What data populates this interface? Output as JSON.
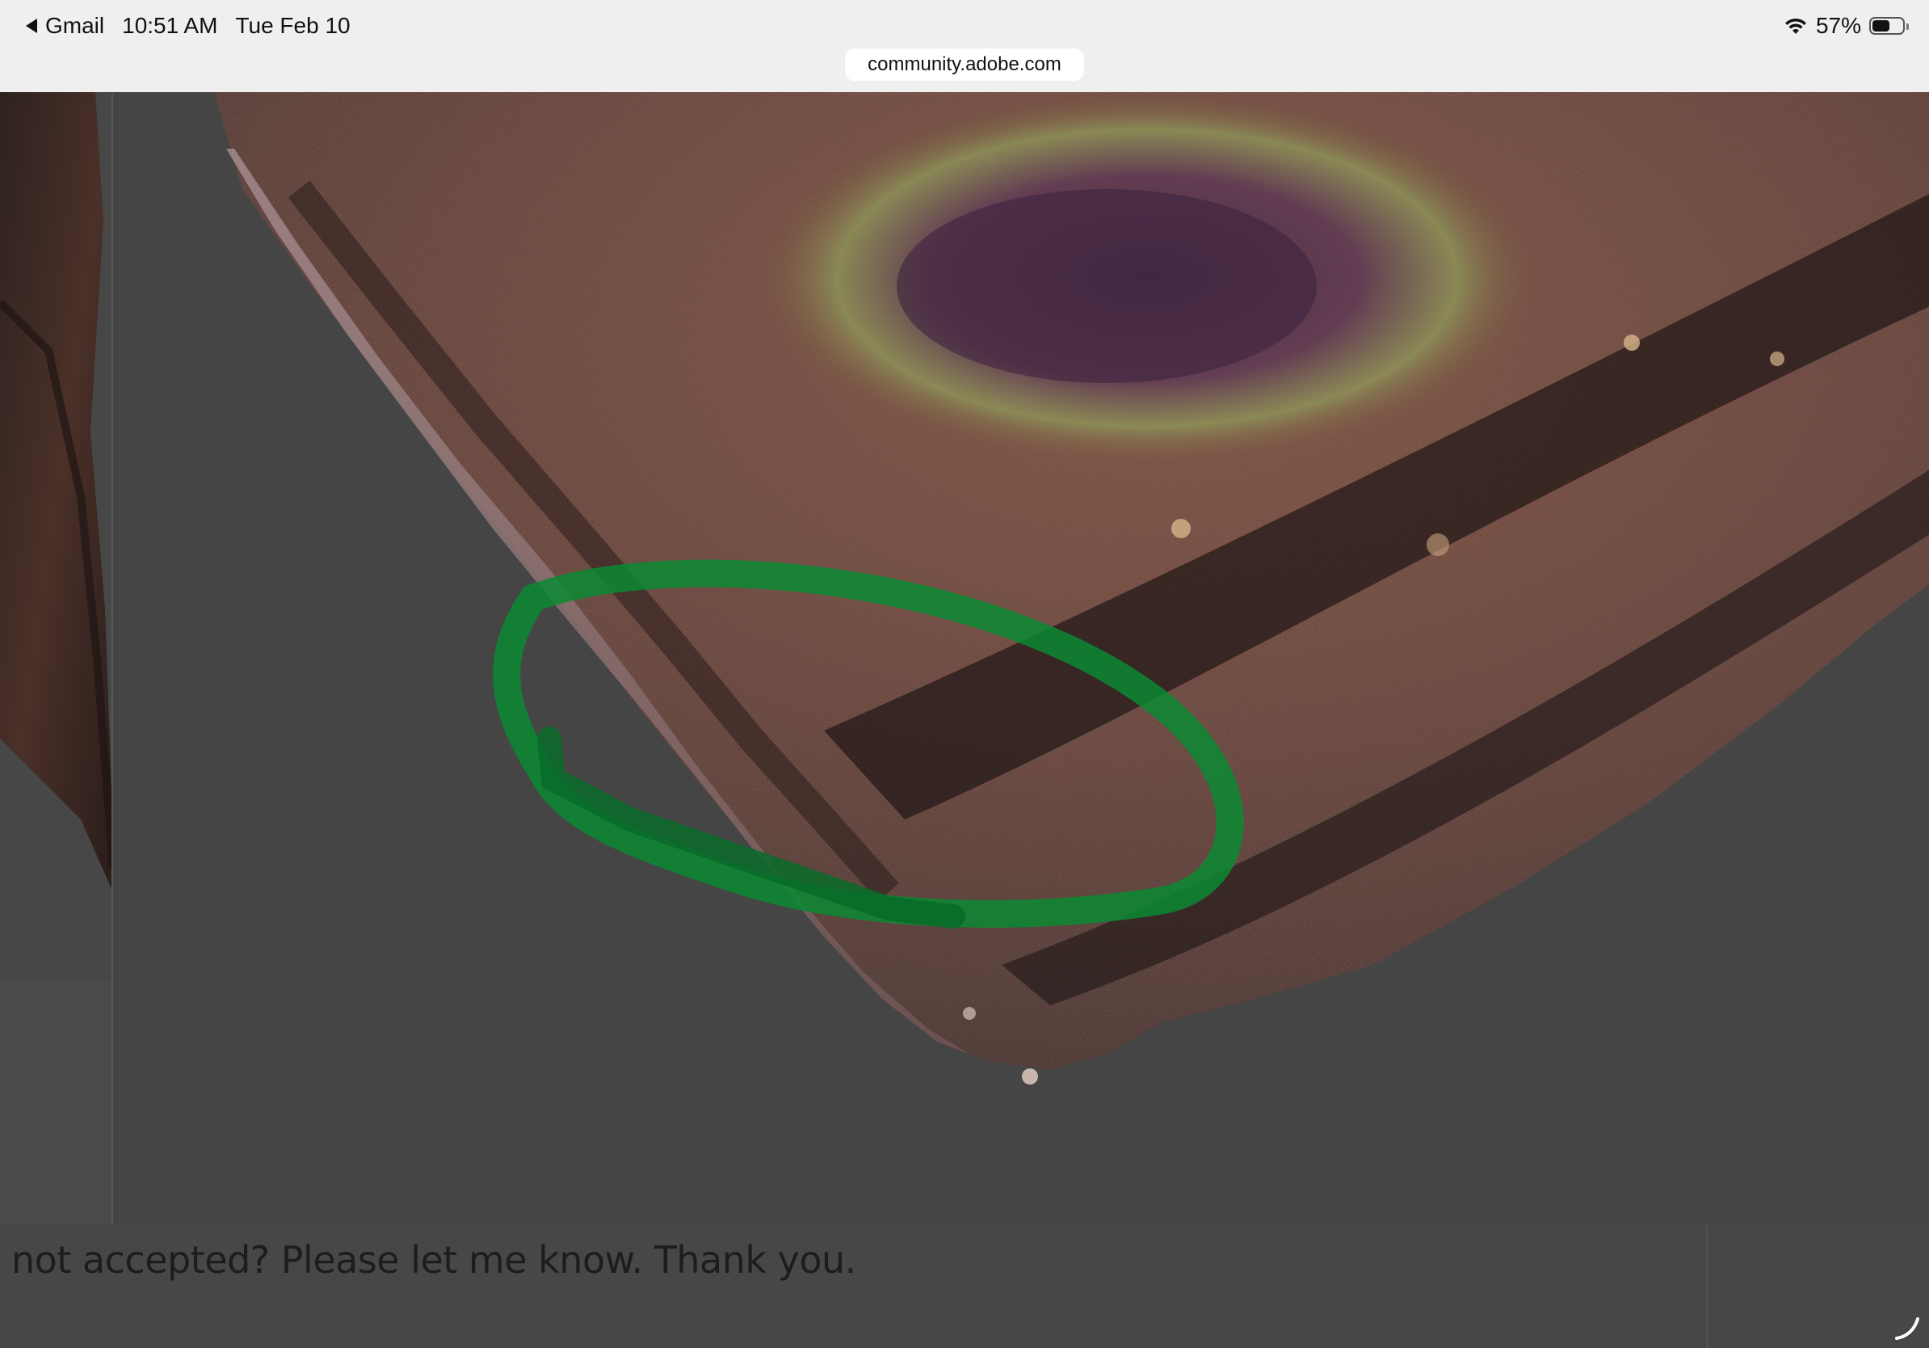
{
  "status_bar": {
    "back_app": "Gmail",
    "time": "10:51 AM",
    "date": "Tue Feb 10",
    "battery_percent": "57%",
    "battery_level": 0.57
  },
  "browser": {
    "url": "community.adobe.com"
  },
  "post": {
    "caption": "not accepted? Please let me know. Thank you."
  },
  "image": {
    "annotation_color": "#0a8a33",
    "background_color": "#454545"
  },
  "icons": [
    "back-icon",
    "wifi-icon",
    "battery-icon",
    "resize-handle-icon"
  ]
}
